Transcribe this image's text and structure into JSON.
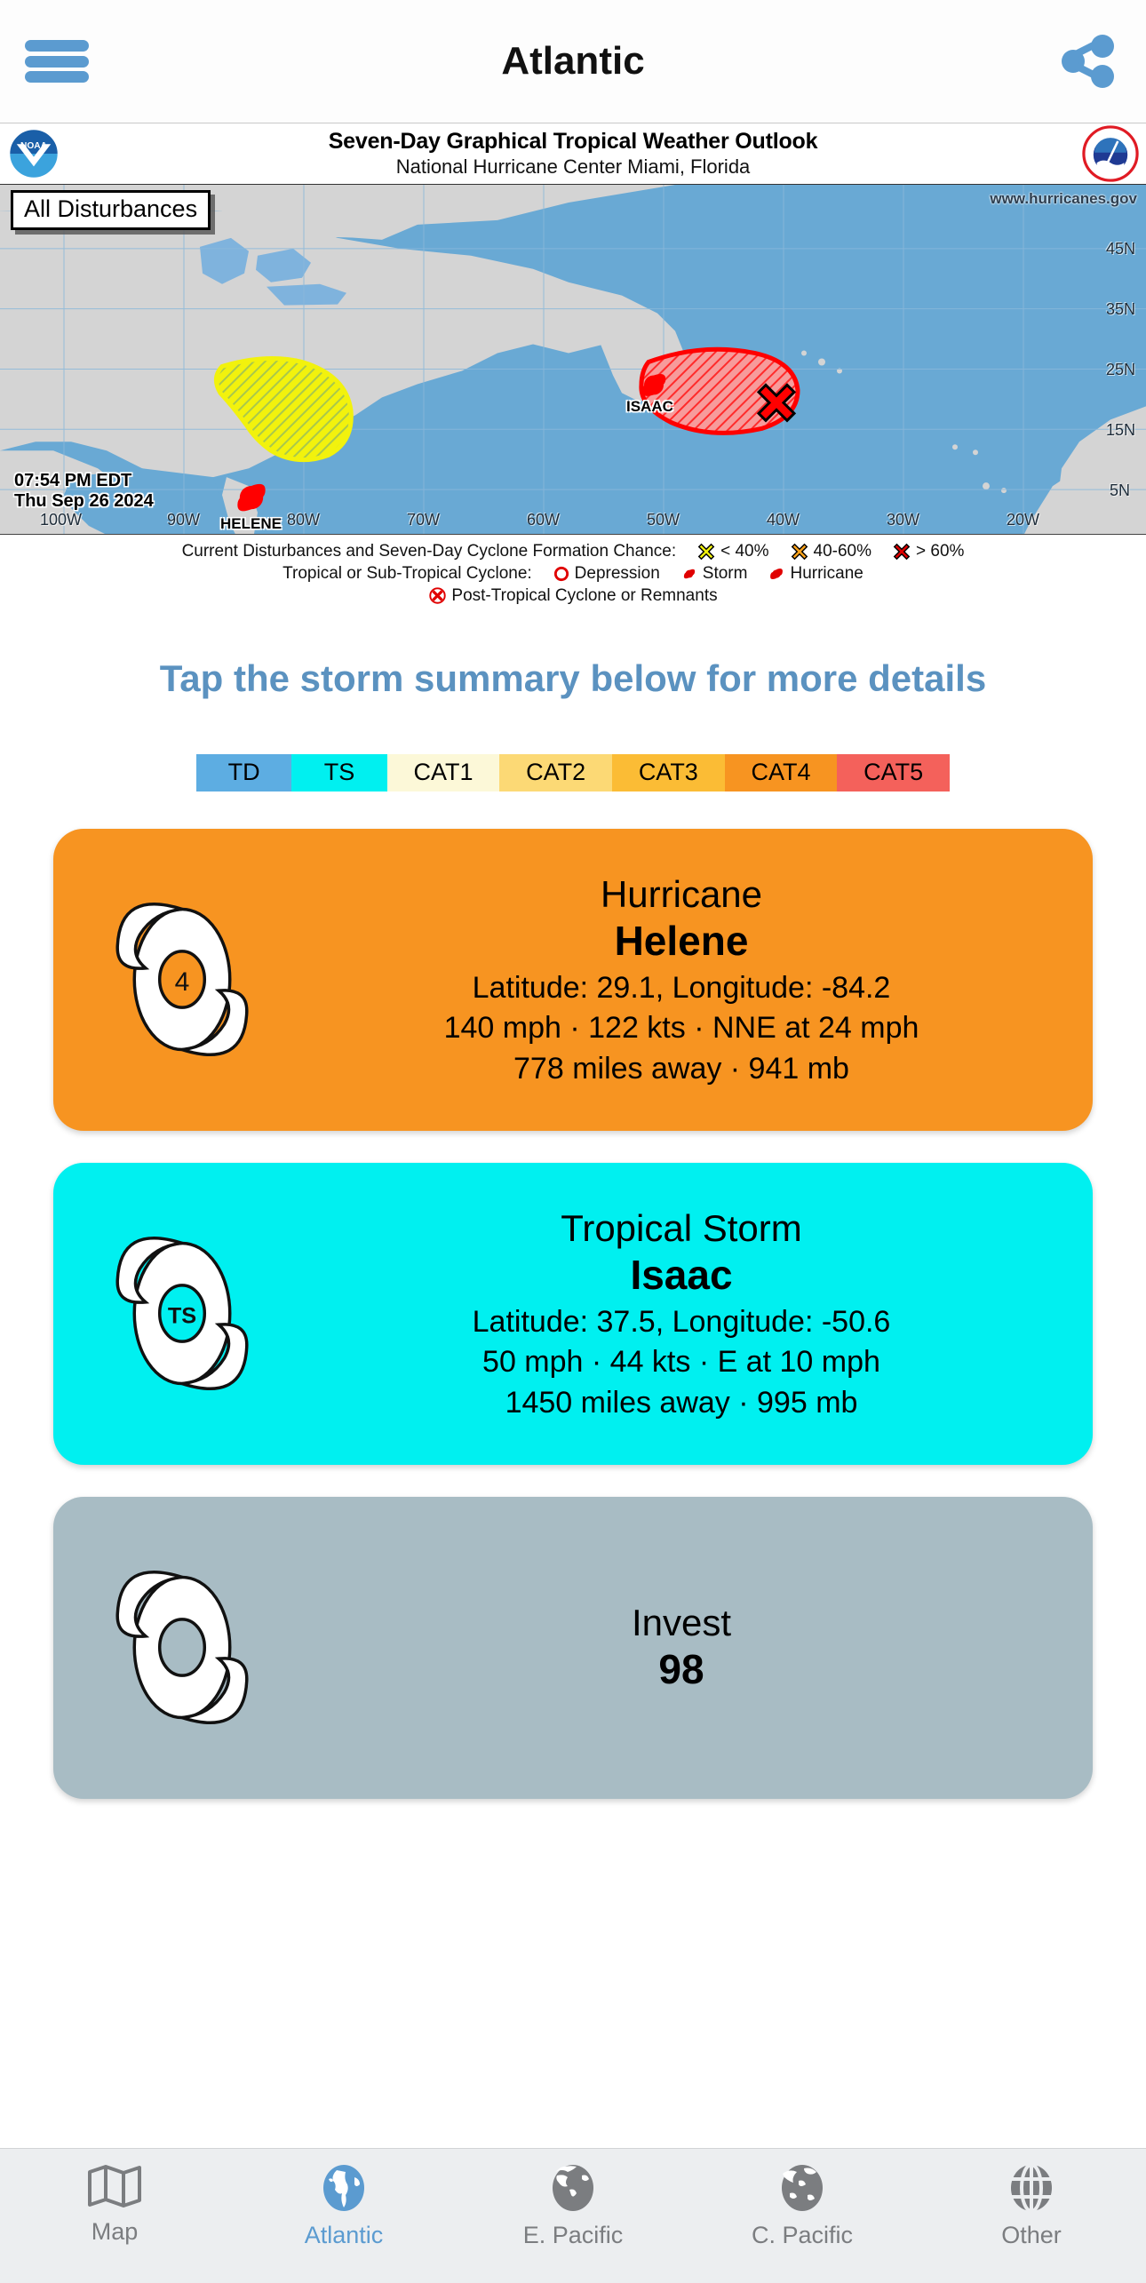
{
  "navbar": {
    "title": "Atlantic",
    "menu_icon": "hamburger-menu-icon",
    "share_icon": "share-icon"
  },
  "nhc_header": {
    "title": "Seven-Day Graphical Tropical Weather Outlook",
    "subtitle": "National Hurricane Center  Miami, Florida",
    "left_logo": "noaa-logo",
    "right_logo": "national-weather-service-logo"
  },
  "map": {
    "badge": "All Disturbances",
    "url": "www.hurricanes.gov",
    "time": "07:54 PM EDT",
    "date": "Thu Sep 26 2024",
    "ocean_color": "#69a9d4",
    "land_color": "#d4d4d4",
    "lat_labels": [
      "45N",
      "35N",
      "25N",
      "15N",
      "5N"
    ],
    "lon_labels": [
      "100W",
      "90W",
      "80W",
      "70W",
      "60W",
      "50W",
      "40W",
      "30W",
      "20W"
    ],
    "storm_markers": [
      {
        "name": "HELENE",
        "type": "hurricane",
        "color": "#ff0000"
      },
      {
        "name": "ISAAC",
        "type": "storm",
        "color": "#ff0000"
      }
    ],
    "disturbance_areas": [
      {
        "name": "caribbean-area",
        "chance": "< 40%",
        "color": "#f2f20d"
      },
      {
        "name": "east-atlantic-area",
        "chance": "> 60%",
        "color": "#ff0000",
        "marker": "x-marker"
      }
    ]
  },
  "legend": {
    "line1_label": "Current Disturbances and Seven-Day Cyclone Formation Chance:",
    "chance_items": [
      {
        "icon": "x-icon-yellow",
        "label": "< 40%",
        "color": "#f2f20d"
      },
      {
        "icon": "x-icon-orange",
        "label": "40-60%",
        "color": "#ffa31a"
      },
      {
        "icon": "x-icon-red",
        "label": "> 60%",
        "color": "#e00000"
      }
    ],
    "line2_label": "Tropical or Sub-Tropical Cyclone:",
    "cyclone_items": [
      {
        "icon": "depression-icon",
        "label": "Depression"
      },
      {
        "icon": "storm-icon",
        "label": "Storm"
      },
      {
        "icon": "hurricane-icon",
        "label": "Hurricane"
      }
    ],
    "line3_icon": "post-tropical-icon",
    "line3_label": "Post-Tropical Cyclone or Remnants"
  },
  "tap_hint": "Tap the storm summary below for more details",
  "category_scale": [
    {
      "label": "TD",
      "color": "#5dade2"
    },
    {
      "label": "TS",
      "color": "#00f0f0"
    },
    {
      "label": "CAT1",
      "color": "#fcf8d8"
    },
    {
      "label": "CAT2",
      "color": "#fcd975"
    },
    {
      "label": "CAT3",
      "color": "#fbbc35"
    },
    {
      "label": "CAT4",
      "color": "#f79421"
    },
    {
      "label": "CAT5",
      "color": "#f4615b"
    }
  ],
  "storm_cards": [
    {
      "type": "Hurricane",
      "name": "Helene",
      "position": "Latitude: 29.1, Longitude: -84.2",
      "wind": "140 mph · 122 kts · NNE at 24 mph",
      "distance": "778 miles away · 941 mb",
      "badge": "4",
      "color": "#f79421",
      "icon": "hurricane-symbol-icon"
    },
    {
      "type": "Tropical Storm",
      "name": "Isaac",
      "position": "Latitude: 37.5, Longitude: -50.6",
      "wind": "50 mph · 44 kts · E at 10 mph",
      "distance": "1450 miles away · 995 mb",
      "badge": "TS",
      "color": "#00f0f0",
      "icon": "tropical-storm-symbol-icon"
    },
    {
      "type": "Invest",
      "name": "98",
      "position": "",
      "wind": "",
      "distance": "",
      "badge": "",
      "color": "#a8bcc4",
      "icon": "invest-symbol-icon"
    }
  ],
  "tabbar": {
    "items": [
      {
        "label": "Map",
        "icon": "map-icon",
        "active": false
      },
      {
        "label": "Atlantic",
        "icon": "globe-atlantic-icon",
        "active": true
      },
      {
        "label": "E. Pacific",
        "icon": "globe-epacific-icon",
        "active": false
      },
      {
        "label": "C. Pacific",
        "icon": "globe-cpacific-icon",
        "active": false
      },
      {
        "label": "Other",
        "icon": "globe-wire-icon",
        "active": false
      }
    ]
  }
}
